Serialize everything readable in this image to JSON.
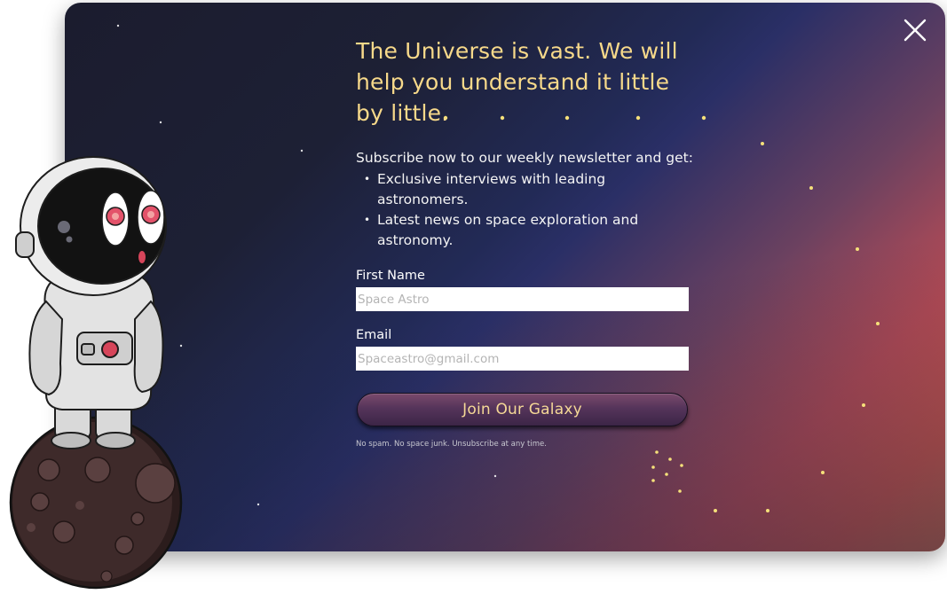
{
  "modal": {
    "headline": "The Universe is vast. We will help you understand it little by little.",
    "intro": "Subscribe now to our weekly newsletter and get:",
    "perks": [
      "Exclusive interviews with leading astronomers.",
      "Latest news on space exploration and astronomy."
    ],
    "form": {
      "first_name_label": "First Name",
      "first_name_placeholder": "Space Astro",
      "email_label": "Email",
      "email_placeholder": "Spaceastro@gmail.com",
      "submit_label": "Join Our Galaxy"
    },
    "disclaimer": "No spam. No space junk. Unsubscribe at any time."
  },
  "colors": {
    "headline": "#f7d98a",
    "button_text": "#f5d896",
    "star": "#f7e27a"
  },
  "icons": {
    "close": "close-icon",
    "illustration": "astronaut-illustration"
  }
}
